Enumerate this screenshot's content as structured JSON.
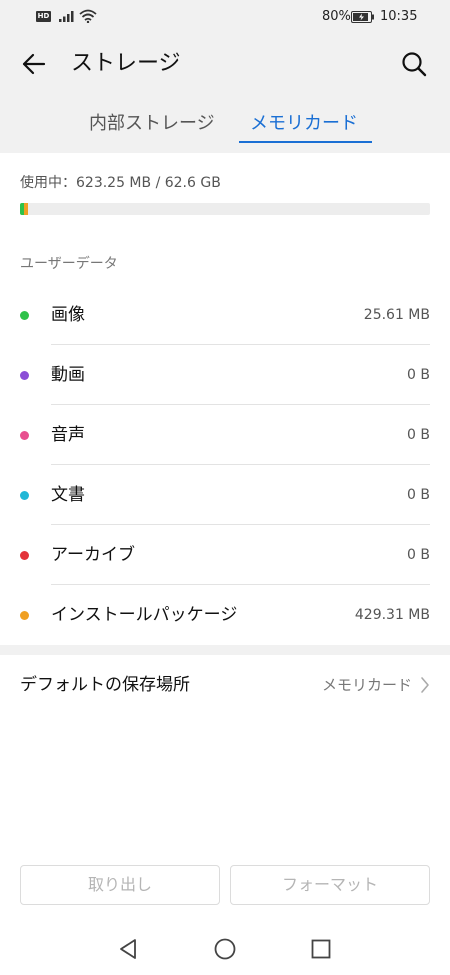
{
  "status_bar": {
    "hd_label": "HD",
    "battery_percent": "80%",
    "time": "10:35"
  },
  "header": {
    "title": "ストレージ",
    "back_icon": "arrow-left-icon",
    "search_icon": "search-icon"
  },
  "tabs": [
    {
      "label": "内部ストレージ",
      "selected": false
    },
    {
      "label": "メモリカード",
      "selected": true
    }
  ],
  "usage": {
    "text": "使用中：623.25 MB / 62.6 GB",
    "segments": [
      {
        "category": "画像",
        "fraction": 0.0004,
        "color": "#2fc24a"
      },
      {
        "category": "インストールパッケージ",
        "fraction": 0.0067,
        "color": "#f0a022"
      }
    ]
  },
  "section": {
    "user_data_label": "ユーザーデータ"
  },
  "categories": [
    {
      "label": "画像",
      "size": "25.61 MB",
      "color": "#2fc24a"
    },
    {
      "label": "動画",
      "size": "0 B",
      "color": "#8b4fd6"
    },
    {
      "label": "音声",
      "size": "0 B",
      "color": "#e8508f"
    },
    {
      "label": "文書",
      "size": "0 B",
      "color": "#22b7d6"
    },
    {
      "label": "アーカイブ",
      "size": "0 B",
      "color": "#e3343b"
    },
    {
      "label": "インストールパッケージ",
      "size": "429.31 MB",
      "color": "#f0a022"
    }
  ],
  "default_storage": {
    "label": "デフォルトの保存場所",
    "value": "メモリカード"
  },
  "buttons": {
    "eject": "取り出し",
    "format": "フォーマット"
  },
  "colors": {
    "accent": "#1a6fd4",
    "background_top": "#f1f1f1"
  }
}
